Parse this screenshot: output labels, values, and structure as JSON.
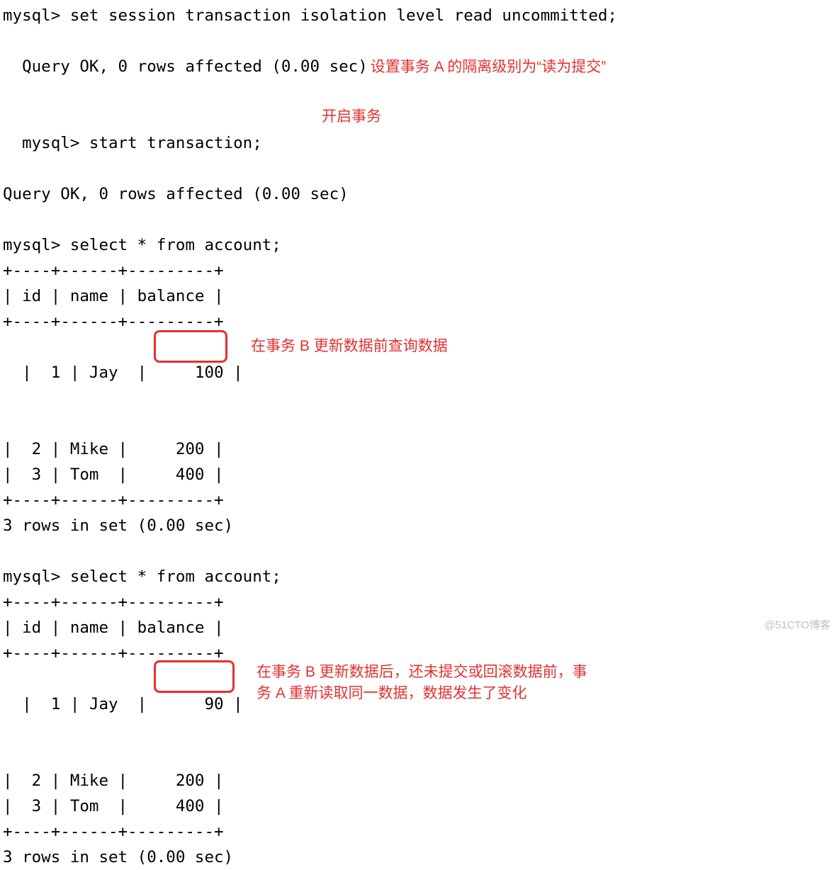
{
  "commands": {
    "cmd1": "mysql> set session transaction isolation level read uncommitted;",
    "resp1": "Query OK, 0 rows affected (0.00 sec)",
    "cmd2": "mysql> start transaction;",
    "resp2": "Query OK, 0 rows affected (0.00 sec)",
    "cmd3": "mysql> select * from account;",
    "cmd4": "mysql> select * from account;"
  },
  "table1": {
    "border_top": "+----+------+---------+",
    "header": "| id | name | balance |",
    "border_mid": "+----+------+---------+",
    "rows": [
      "|  1 | Jay  |     100 |",
      "|  2 | Mike |     200 |",
      "|  3 | Tom  |     400 |"
    ],
    "border_bot": "+----+------+---------+",
    "footer": "3 rows in set (0.00 sec)"
  },
  "table2": {
    "border_top": "+----+------+---------+",
    "header": "| id | name | balance |",
    "border_mid": "+----+------+---------+",
    "rows": [
      "|  1 | Jay  |      90 |",
      "|  2 | Mike |     200 |",
      "|  3 | Tom  |     400 |"
    ],
    "border_bot": "+----+------+---------+",
    "footer": "3 rows in set (0.00 sec)"
  },
  "annotations": {
    "a1": "设置事务 A 的隔离级别为“读为提交”",
    "a2": "开启事务",
    "a3": "在事务 B 更新数据前查询数据",
    "a4": "在事务 B 更新数据后，还未提交或回滚数据前，事务 A 重新读取同一数据，数据发生了变化"
  },
  "watermark": "@51CTO博客"
}
